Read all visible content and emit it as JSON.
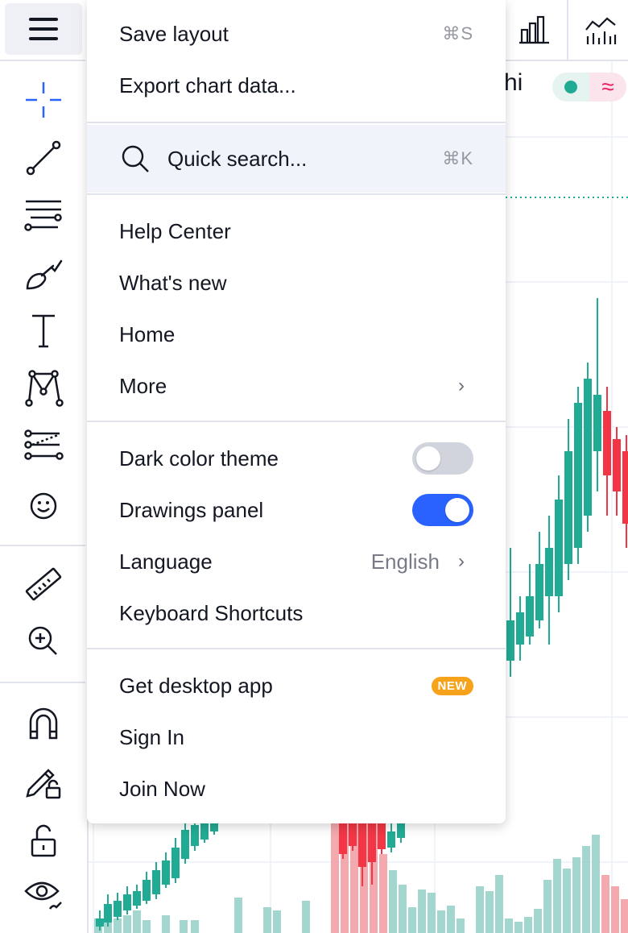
{
  "menu": {
    "save_layout": {
      "label": "Save layout",
      "shortcut": "⌘S"
    },
    "export_chart_data": {
      "label": "Export chart data..."
    },
    "quick_search": {
      "label": "Quick search...",
      "shortcut": "⌘K"
    },
    "help_center": {
      "label": "Help Center"
    },
    "whats_new": {
      "label": "What's new"
    },
    "home": {
      "label": "Home"
    },
    "more": {
      "label": "More"
    },
    "dark_color_theme": {
      "label": "Dark color theme",
      "enabled": false
    },
    "drawings_panel": {
      "label": "Drawings panel",
      "enabled": true
    },
    "language": {
      "label": "Language",
      "value": "English"
    },
    "keyboard_shortcuts": {
      "label": "Keyboard Shortcuts"
    },
    "get_desktop_app": {
      "label": "Get desktop app",
      "badge": "NEW"
    },
    "sign_in": {
      "label": "Sign In"
    },
    "join_now": {
      "label": "Join Now"
    }
  },
  "chart": {
    "symbol_fragment": "hi",
    "status_approx": "≈"
  },
  "colors": {
    "up": "#22ab94",
    "down": "#f23645",
    "accent": "#2962ff",
    "badge": "#f7a21b"
  },
  "icons": [
    "hamburger-menu-icon",
    "crosshair-icon",
    "trend-line-icon",
    "fib-retracement-icon",
    "brush-icon",
    "text-icon",
    "pattern-icon",
    "prediction-icon",
    "emoji-icon",
    "ruler-icon",
    "zoom-in-icon",
    "magnet-icon",
    "lock-drawing-icon",
    "lock-icon",
    "eye-icon",
    "bar-chart-icon",
    "indicators-icon",
    "search-icon",
    "chevron-right-icon"
  ]
}
